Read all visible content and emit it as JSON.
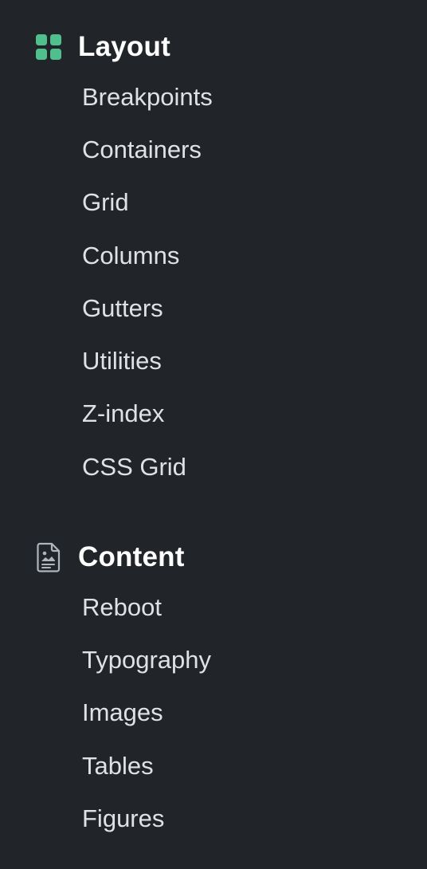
{
  "sidebar": {
    "sections": [
      {
        "title": "Layout",
        "icon": "grid-icon",
        "icon_color": "#4fc08d",
        "items": [
          {
            "label": "Breakpoints"
          },
          {
            "label": "Containers"
          },
          {
            "label": "Grid"
          },
          {
            "label": "Columns"
          },
          {
            "label": "Gutters"
          },
          {
            "label": "Utilities"
          },
          {
            "label": "Z-index"
          },
          {
            "label": "CSS Grid"
          }
        ]
      },
      {
        "title": "Content",
        "icon": "document-image-icon",
        "icon_color": "#adb5bd",
        "items": [
          {
            "label": "Reboot"
          },
          {
            "label": "Typography"
          },
          {
            "label": "Images"
          },
          {
            "label": "Tables"
          },
          {
            "label": "Figures"
          }
        ]
      }
    ]
  }
}
